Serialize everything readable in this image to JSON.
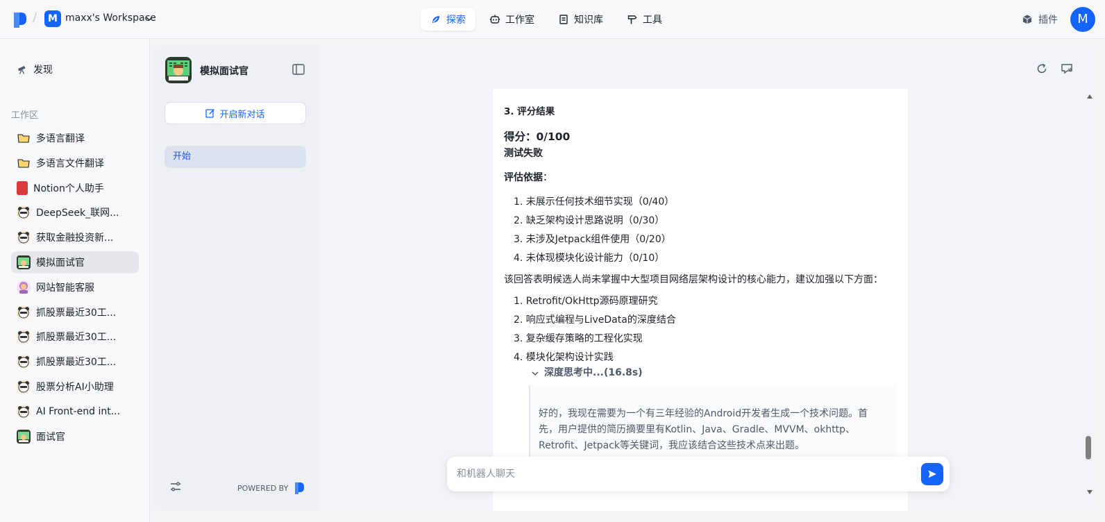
{
  "header": {
    "workspace_initial": "M",
    "workspace_name": "maxx's Workspace",
    "nav": [
      {
        "label": "探索",
        "icon": "explore-icon",
        "active": true
      },
      {
        "label": "工作室",
        "icon": "robot-icon",
        "active": false
      },
      {
        "label": "知识库",
        "icon": "book-icon",
        "active": false
      },
      {
        "label": "工具",
        "icon": "hammer-icon",
        "active": false
      }
    ],
    "plugin_label": "插件",
    "user_initial": "M"
  },
  "sidebar": {
    "discover_label": "发现",
    "section_label": "工作区",
    "items": [
      {
        "label": "多语言翻译",
        "icon": "folder-icon"
      },
      {
        "label": "多语言文件翻译",
        "icon": "folder-icon"
      },
      {
        "label": "Notion个人助手",
        "icon": "notebook-icon"
      },
      {
        "label": "DeepSeek_联网...",
        "icon": "bear-icon"
      },
      {
        "label": "获取金融投资新...",
        "icon": "bear-icon"
      },
      {
        "label": "模拟面试官",
        "icon": "computer-avatar-icon"
      },
      {
        "label": "网站智能客服",
        "icon": "service-girl-icon"
      },
      {
        "label": "抓股票最近30工...",
        "icon": "bear-icon"
      },
      {
        "label": "抓股票最近30工...",
        "icon": "bear-icon"
      },
      {
        "label": "抓股票最近30工...",
        "icon": "bear-icon"
      },
      {
        "label": "股票分析AI小助理",
        "icon": "bear-icon"
      },
      {
        "label": "AI Front-end int...",
        "icon": "bear-icon"
      },
      {
        "label": "面试官",
        "icon": "computer-avatar-icon"
      }
    ]
  },
  "bot_panel": {
    "bot_name": "模拟面试官",
    "new_chat_label": "开启新对话",
    "conversation_label": "开始",
    "powered_by": "POWERED BY"
  },
  "chat": {
    "section_title": "3. 评分结果",
    "score": "得分：0/100",
    "fail": "测试失败",
    "basis_label": "评估依据",
    "basis_colon": "：",
    "basis_items": [
      "1. 未展示任何技术细节实现（0/40）",
      "2. 缺乏架构设计思路说明（0/30）",
      "3. 未涉及Jetpack组件使用（0/20）",
      "4. 未体现模块化设计能力（0/10）"
    ],
    "summary": "该回答表明候选人尚未掌握中大型项目网络层架构设计的核心能力，建议加强以下方面：",
    "suggestions": [
      "1. Retrofit/OkHttp源码原理研究",
      "2. 响应式编程与LiveData的深度结合",
      "3. 复杂缓存策略的工程化实现",
      "4. 模块化架构设计实践"
    ],
    "thinking_label": "深度思考中...(16.8s)",
    "thinking_text": "好的，我现在需要为一个有三年经验的Android开发者生成一个技术问题。首先，用户提供的简历摘要里有Kotlin、Java、Gradle、MVVM、okhttp、Retrofit、Jetpack等关键词，我应该结合这些技术点来出题。",
    "input_placeholder": "和机器人聊天"
  }
}
